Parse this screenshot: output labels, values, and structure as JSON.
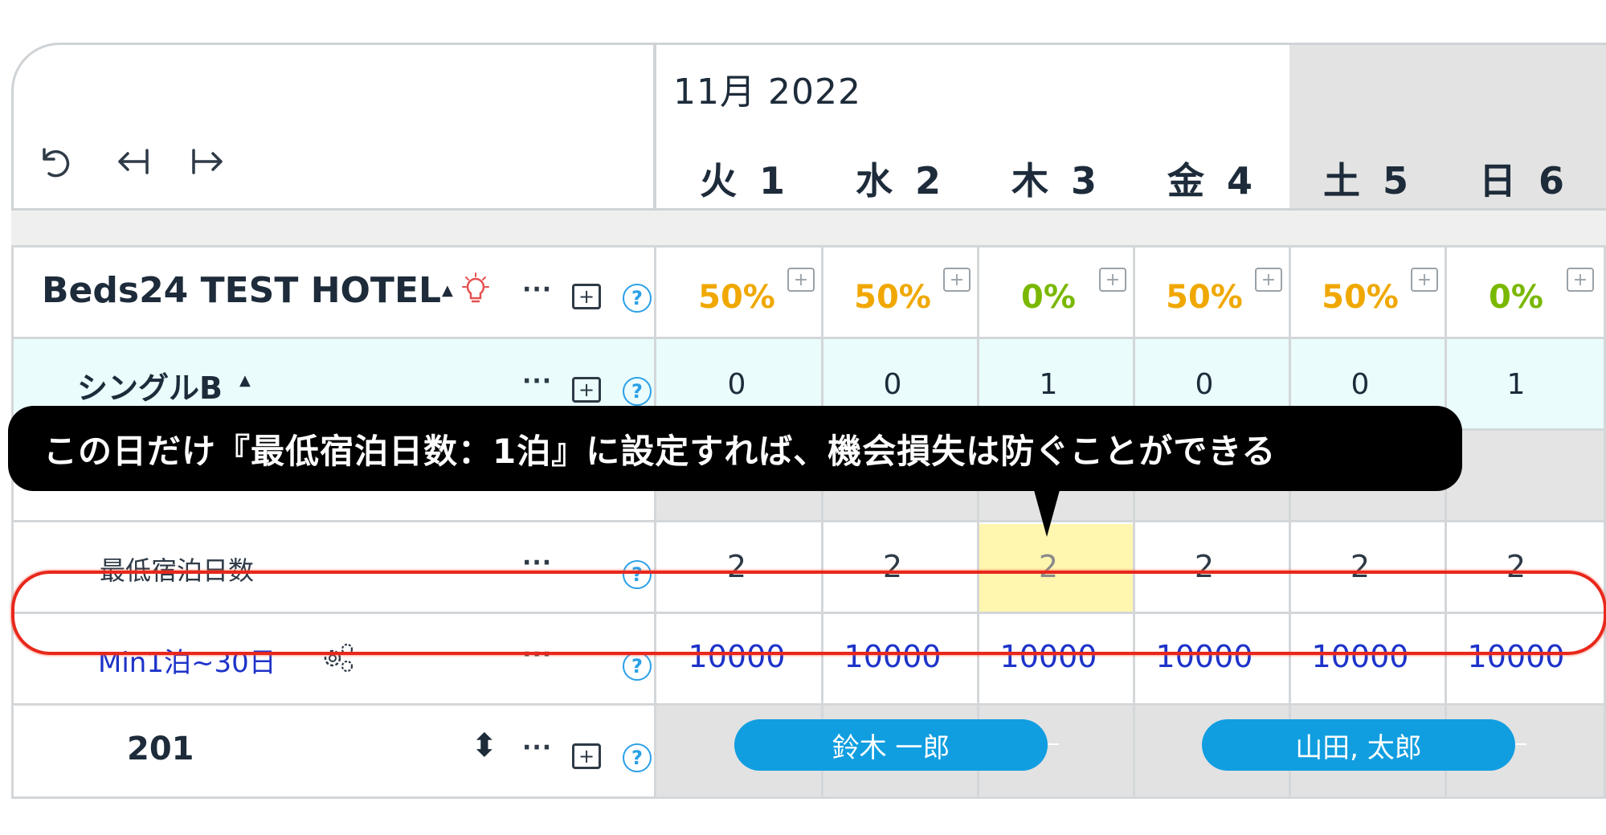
{
  "toolbar": {
    "undo_icon": "undo-icon",
    "collapse_icon": "arrow-left-bar-icon",
    "expand_icon": "arrow-right-bar-icon"
  },
  "calendar": {
    "month": "11月 2022",
    "days": [
      "火 1",
      "水 2",
      "木 3",
      "金 4",
      "土 5",
      "日 6"
    ],
    "weekend_days": [
      "土 5",
      "日 6"
    ]
  },
  "property": {
    "name": "Beds24 TEST HOTEL",
    "occupancy": [
      "50%",
      "50%",
      "0%",
      "50%",
      "50%",
      "0%"
    ],
    "occupancy_colors": [
      "#f0a800",
      "#f0a800",
      "#7ab800",
      "#f0a800",
      "#f0a800",
      "#7ab800"
    ]
  },
  "room_type": {
    "name": "シングルB",
    "counts": [
      "0",
      "0",
      "1",
      "0",
      "0",
      "1"
    ]
  },
  "min_stay": {
    "label": "最低宿泊日数",
    "values": [
      "2",
      "2",
      "2",
      "2",
      "2",
      "2"
    ],
    "highlight_index": 2
  },
  "rate": {
    "label": "Min1泊~30日",
    "prices": [
      "10000",
      "10000",
      "10000",
      "10000",
      "10000",
      "10000"
    ]
  },
  "room": {
    "number": "201",
    "bookings": [
      "鈴木 一郎",
      "山田, 太郎"
    ]
  },
  "common": {
    "dots": "···",
    "help": "?",
    "comment_plus": "+",
    "caret_up": "▲",
    "sort": "⬍"
  },
  "callout": {
    "text": "この日だけ『最低宿泊日数：1泊』に設定すれば、機会損失は防ぐことができる"
  },
  "colors": {
    "accent_blue": "#109ee0",
    "price_blue": "#1d33c9",
    "highlight_yellow": "#fff6b0",
    "row_tint": "#eafcfc",
    "annotation_red": "#e8281c"
  }
}
